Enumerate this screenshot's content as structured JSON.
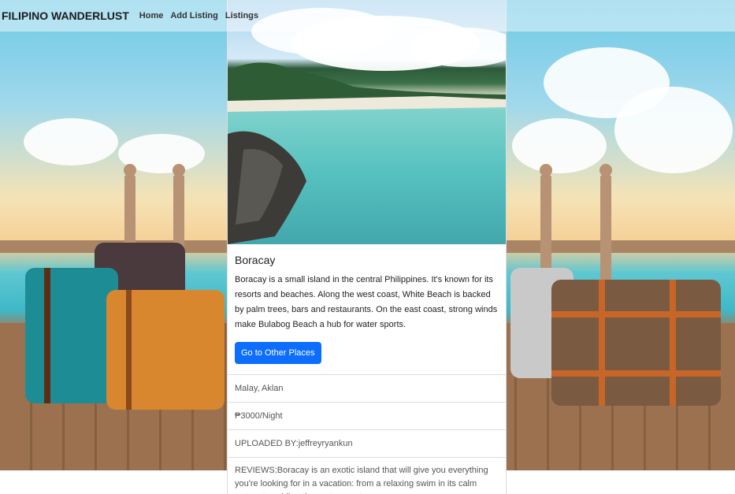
{
  "navbar": {
    "brand": "FILIPINO WANDERLUST",
    "links": [
      "Home",
      "Add Listing",
      "Listings"
    ]
  },
  "listing": {
    "title": "Boracay",
    "description": "Boracay is a small island in the central Philippines. It's known for its resorts and beaches. Along the west coast, White Beach is backed by palm trees, bars and restaurants. On the east coast, strong winds make Bulabog Beach a hub for water sports.",
    "button_label": "Go to Other Places",
    "location": "Malay, Aklan",
    "price": "₱3000/Night",
    "uploaded_by": "UPLOADED BY:jeffreyryankun",
    "reviews": "REVIEWS:Boracay is an exotic island that will give you everything you're looking for in a vacation: from a relaxing swim in its calm waters to exhilarating water sports."
  },
  "colors": {
    "button": "#0d6efd",
    "card_bg": "#ffffff",
    "divider": "#dddddd"
  }
}
